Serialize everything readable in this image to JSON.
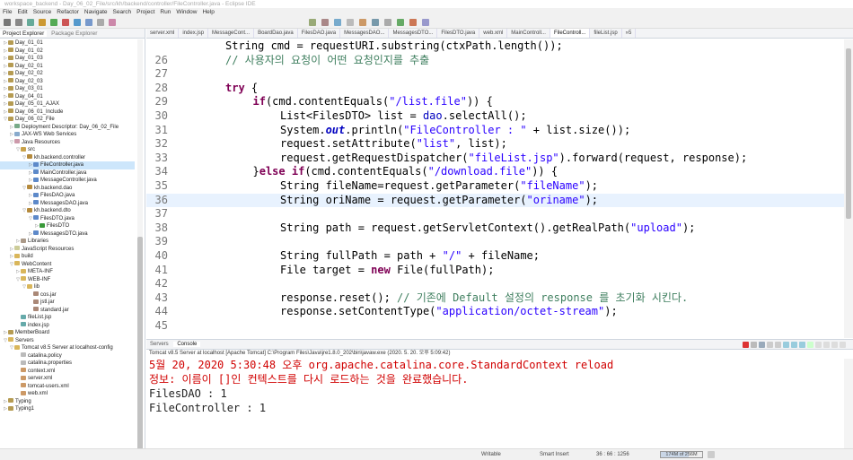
{
  "window": {
    "title": "workspace_backend - Day_06_02_File/src/kh/backend/controller/FileController.java - Eclipse IDE"
  },
  "menu": [
    "File",
    "Edit",
    "Source",
    "Refactor",
    "Navigate",
    "Search",
    "Project",
    "Run",
    "Window",
    "Help"
  ],
  "left_panel": {
    "tabs": {
      "project_explorer": "Project Explorer",
      "package_explorer": "Package Explorer"
    },
    "tree": [
      {
        "label": "Day_01_01",
        "depth": 0,
        "arrow": "▷",
        "icon": "project"
      },
      {
        "label": "Day_01_02",
        "depth": 0,
        "arrow": "▷",
        "icon": "project"
      },
      {
        "label": "Day_01_03",
        "depth": 0,
        "arrow": "▷",
        "icon": "project"
      },
      {
        "label": "Day_02_01",
        "depth": 0,
        "arrow": "▷",
        "icon": "project"
      },
      {
        "label": "Day_02_02",
        "depth": 0,
        "arrow": "▷",
        "icon": "project"
      },
      {
        "label": "Day_02_03",
        "depth": 0,
        "arrow": "▷",
        "icon": "project"
      },
      {
        "label": "Day_03_01",
        "depth": 0,
        "arrow": "▷",
        "icon": "project"
      },
      {
        "label": "Day_04_01",
        "depth": 0,
        "arrow": "▷",
        "icon": "project"
      },
      {
        "label": "Day_05_01_AJAX",
        "depth": 0,
        "arrow": "▷",
        "icon": "project"
      },
      {
        "label": "Day_06_01_Include",
        "depth": 0,
        "arrow": "▷",
        "icon": "project"
      },
      {
        "label": "Day_06_02_File",
        "depth": 0,
        "arrow": "▽",
        "icon": "project"
      },
      {
        "label": "Deployment Descriptor: Day_06_02_File",
        "depth": 1,
        "arrow": "▷",
        "icon": "descriptor"
      },
      {
        "label": "JAX-WS Web Services",
        "depth": 1,
        "arrow": "▷",
        "icon": "ws"
      },
      {
        "label": "Java Resources",
        "depth": 1,
        "arrow": "▽",
        "icon": "jres"
      },
      {
        "label": "src",
        "depth": 2,
        "arrow": "▽",
        "icon": "src"
      },
      {
        "label": "kh.backend.controller",
        "depth": 3,
        "arrow": "▽",
        "icon": "pkg"
      },
      {
        "label": "FileController.java",
        "depth": 4,
        "arrow": "▷",
        "icon": "java",
        "selected": true
      },
      {
        "label": "MainController.java",
        "depth": 4,
        "arrow": "▷",
        "icon": "java"
      },
      {
        "label": "MessageController.java",
        "depth": 4,
        "arrow": "▷",
        "icon": "java"
      },
      {
        "label": "kh.backend.dao",
        "depth": 3,
        "arrow": "▽",
        "icon": "pkg"
      },
      {
        "label": "FilesDAO.java",
        "depth": 4,
        "arrow": "▷",
        "icon": "java"
      },
      {
        "label": "MessagesDAO.java",
        "depth": 4,
        "arrow": "▷",
        "icon": "java"
      },
      {
        "label": "kh.backend.dto",
        "depth": 3,
        "arrow": "▽",
        "icon": "pkg"
      },
      {
        "label": "FilesDTO.java",
        "depth": 4,
        "arrow": "▽",
        "icon": "java"
      },
      {
        "label": "FilesDTO",
        "depth": 5,
        "arrow": "▷",
        "icon": "class"
      },
      {
        "label": "MessagesDTO.java",
        "depth": 4,
        "arrow": "▷",
        "icon": "java"
      },
      {
        "label": "Libraries",
        "depth": 2,
        "arrow": "▷",
        "icon": "lib"
      },
      {
        "label": "JavaScript Resources",
        "depth": 1,
        "arrow": "▷",
        "icon": "js"
      },
      {
        "label": "build",
        "depth": 1,
        "arrow": "▷",
        "icon": "folder"
      },
      {
        "label": "WebContent",
        "depth": 1,
        "arrow": "▽",
        "icon": "folder"
      },
      {
        "label": "META-INF",
        "depth": 2,
        "arrow": "▷",
        "icon": "folder"
      },
      {
        "label": "WEB-INF",
        "depth": 2,
        "arrow": "▽",
        "icon": "folder"
      },
      {
        "label": "lib",
        "depth": 3,
        "arrow": "▽",
        "icon": "folder"
      },
      {
        "label": "cos.jar",
        "depth": 4,
        "arrow": "",
        "icon": "jar"
      },
      {
        "label": "jstl.jar",
        "depth": 4,
        "arrow": "",
        "icon": "jar"
      },
      {
        "label": "standard.jar",
        "depth": 4,
        "arrow": "",
        "icon": "jar"
      },
      {
        "label": "fileList.jsp",
        "depth": 2,
        "arrow": "",
        "icon": "jsp"
      },
      {
        "label": "index.jsp",
        "depth": 2,
        "arrow": "",
        "icon": "jsp"
      },
      {
        "label": "MemberBoard",
        "depth": 0,
        "arrow": "▷",
        "icon": "project"
      },
      {
        "label": "Servers",
        "depth": 0,
        "arrow": "▽",
        "icon": "folder"
      },
      {
        "label": "Tomcat v8.5 Server at localhost-config",
        "depth": 1,
        "arrow": "▽",
        "icon": "folder"
      },
      {
        "label": "catalina.policy",
        "depth": 2,
        "arrow": "",
        "icon": "file"
      },
      {
        "label": "catalina.properties",
        "depth": 2,
        "arrow": "",
        "icon": "file"
      },
      {
        "label": "context.xml",
        "depth": 2,
        "arrow": "",
        "icon": "xml"
      },
      {
        "label": "server.xml",
        "depth": 2,
        "arrow": "",
        "icon": "xml"
      },
      {
        "label": "tomcat-users.xml",
        "depth": 2,
        "arrow": "",
        "icon": "xml"
      },
      {
        "label": "web.xml",
        "depth": 2,
        "arrow": "",
        "icon": "xml"
      },
      {
        "label": "Typing",
        "depth": 0,
        "arrow": "▷",
        "icon": "project"
      },
      {
        "label": "Typing1",
        "depth": 0,
        "arrow": "▷",
        "icon": "project"
      }
    ]
  },
  "editor": {
    "tabs": [
      {
        "label": "server.xml",
        "active": false
      },
      {
        "label": "index.jsp",
        "active": false
      },
      {
        "label": "MessageCont...",
        "active": false
      },
      {
        "label": "BoardDao.java",
        "active": false
      },
      {
        "label": "FilesDAO.java",
        "active": false
      },
      {
        "label": "MessagesDAO...",
        "active": false
      },
      {
        "label": "MessagesDTO...",
        "active": false
      },
      {
        "label": "FilesDTO.java",
        "active": false
      },
      {
        "label": "web.xml",
        "active": false
      },
      {
        "label": "MainControll...",
        "active": false
      },
      {
        "label": "FileControll...",
        "active": true
      },
      {
        "label": "fileList.jsp",
        "active": false
      },
      {
        "label": "»5",
        "active": false
      }
    ],
    "lines": [
      {
        "n": "",
        "indent": 2,
        "tokens": [
          {
            "t": "String cmd = requestURI.substring(ctxPath.length());",
            "c": ""
          }
        ]
      },
      {
        "n": "26",
        "indent": 2,
        "tokens": [
          {
            "t": "// 사용자의 요청이 어떤 요청인지를 추출",
            "c": "cm"
          }
        ]
      },
      {
        "n": "27",
        "indent": 0,
        "tokens": []
      },
      {
        "n": "28",
        "indent": 2,
        "tokens": [
          {
            "t": "try",
            "c": "kw"
          },
          {
            "t": " {",
            "c": ""
          }
        ]
      },
      {
        "n": "29",
        "indent": 3,
        "tokens": [
          {
            "t": "if",
            "c": "kw"
          },
          {
            "t": "(cmd.contentEquals(",
            "c": ""
          },
          {
            "t": "\"/list.file\"",
            "c": "st"
          },
          {
            "t": ")) {",
            "c": ""
          }
        ]
      },
      {
        "n": "30",
        "indent": 4,
        "tokens": [
          {
            "t": "List<FilesDTO> list = ",
            "c": ""
          },
          {
            "t": "dao",
            "c": "fd2"
          },
          {
            "t": ".selectAll();",
            "c": ""
          }
        ]
      },
      {
        "n": "31",
        "indent": 4,
        "tokens": [
          {
            "t": "System.",
            "c": ""
          },
          {
            "t": "out",
            "c": "fd"
          },
          {
            "t": ".println(",
            "c": ""
          },
          {
            "t": "\"FileController : \"",
            "c": "st"
          },
          {
            "t": " + list.size());",
            "c": ""
          }
        ]
      },
      {
        "n": "32",
        "indent": 4,
        "tokens": [
          {
            "t": "request.setAttribute(",
            "c": ""
          },
          {
            "t": "\"list\"",
            "c": "st"
          },
          {
            "t": ", list);",
            "c": ""
          }
        ]
      },
      {
        "n": "33",
        "indent": 4,
        "tokens": [
          {
            "t": "request.getRequestDispatcher(",
            "c": ""
          },
          {
            "t": "\"fileList.jsp\"",
            "c": "st"
          },
          {
            "t": ").forward(request, response);",
            "c": ""
          }
        ]
      },
      {
        "n": "34",
        "indent": 3,
        "tokens": [
          {
            "t": "}",
            "c": ""
          },
          {
            "t": "else",
            "c": "kw"
          },
          {
            "t": " ",
            "c": ""
          },
          {
            "t": "if",
            "c": "kw"
          },
          {
            "t": "(cmd.contentEquals(",
            "c": ""
          },
          {
            "t": "\"/download.file\"",
            "c": "st"
          },
          {
            "t": ")) {",
            "c": ""
          }
        ]
      },
      {
        "n": "35",
        "indent": 4,
        "tokens": [
          {
            "t": "String fileName=request.getParameter(",
            "c": ""
          },
          {
            "t": "\"fileName\"",
            "c": "st"
          },
          {
            "t": ");",
            "c": ""
          }
        ]
      },
      {
        "n": "36",
        "indent": 4,
        "current": true,
        "tokens": [
          {
            "t": "String oriName = request.getParameter(",
            "c": ""
          },
          {
            "t": "\"oriname\"",
            "c": "st"
          },
          {
            "t": ");",
            "c": ""
          }
        ]
      },
      {
        "n": "37",
        "indent": 0,
        "tokens": []
      },
      {
        "n": "38",
        "indent": 4,
        "tokens": [
          {
            "t": "String path = request.getServletContext().getRealPath(",
            "c": ""
          },
          {
            "t": "\"upload\"",
            "c": "st"
          },
          {
            "t": ");",
            "c": ""
          }
        ]
      },
      {
        "n": "39",
        "indent": 0,
        "tokens": []
      },
      {
        "n": "40",
        "indent": 4,
        "tokens": [
          {
            "t": "String fullPath = path + ",
            "c": ""
          },
          {
            "t": "\"/\"",
            "c": "st"
          },
          {
            "t": " + fileName;",
            "c": ""
          }
        ]
      },
      {
        "n": "41",
        "indent": 4,
        "tokens": [
          {
            "t": "File target = ",
            "c": ""
          },
          {
            "t": "new",
            "c": "kw"
          },
          {
            "t": " File(fullPath);",
            "c": ""
          }
        ]
      },
      {
        "n": "42",
        "indent": 0,
        "tokens": []
      },
      {
        "n": "43",
        "indent": 4,
        "tokens": [
          {
            "t": "response.reset(); ",
            "c": ""
          },
          {
            "t": "// 기존에 Default 설정의 response 를 초기화 시킨다.",
            "c": "cm"
          }
        ]
      },
      {
        "n": "44",
        "indent": 4,
        "tokens": [
          {
            "t": "response.setContentType(",
            "c": ""
          },
          {
            "t": "\"application/octet-stream\"",
            "c": "st"
          },
          {
            "t": ");",
            "c": ""
          }
        ]
      },
      {
        "n": "45",
        "indent": 0,
        "tokens": []
      }
    ]
  },
  "console": {
    "tabs": {
      "servers": "Servers",
      "console": "Console"
    },
    "description": "Tomcat v8.5 Server at localhost [Apache Tomcat] C:\\Program Files\\Java\\jre1.8.0_202\\bin\\javaw.exe (2020. 5. 20. 오후 5:09:42)",
    "lines": [
      {
        "text": "5월 20, 2020 5:30:48 오후 org.apache.catalina.core.StandardContext reload",
        "red": true
      },
      {
        "text": "정보: 이름이 []인 컨텍스트를 다시 로드하는 것을 완료했습니다.",
        "red": true
      },
      {
        "text": "FilesDAO : 1",
        "red": false
      },
      {
        "text": "FileController : 1",
        "red": false
      }
    ]
  },
  "status": {
    "writable": "Writable",
    "insert_mode": "Smart Insert",
    "position": "36 : 66 : 1256",
    "heap": "174M of 256M",
    "heap_used_fraction": 0.68
  },
  "colors": {
    "keyword": "#7f0055",
    "string": "#2a00ff",
    "comment": "#3f7f5f",
    "field": "#0000c0",
    "console_error": "#d00000",
    "selection": "#cde6fb"
  }
}
